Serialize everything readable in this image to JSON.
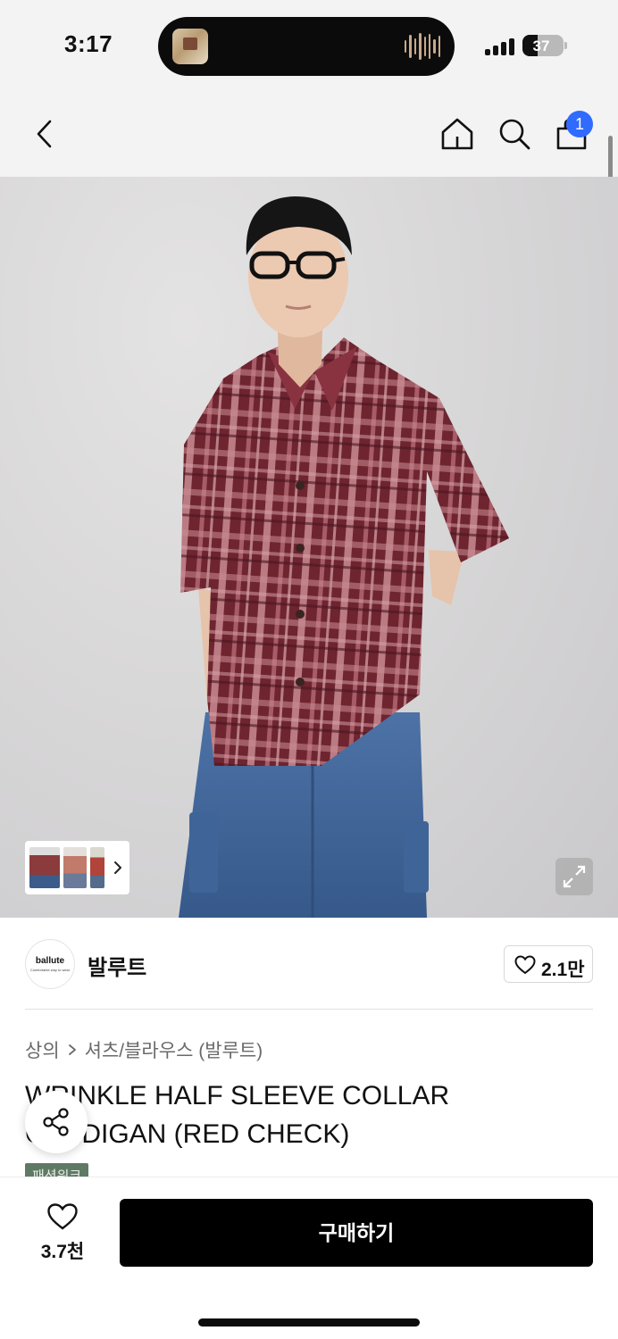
{
  "status_bar": {
    "time": "3:17",
    "battery_level": "37",
    "signal_icon": "cellular-signal-icon",
    "now_playing_icon": "audio-waveform-icon"
  },
  "nav": {
    "back_icon": "chevron-left-icon",
    "home_icon": "home-icon",
    "search_icon": "search-icon",
    "cart_icon": "shopping-bag-icon",
    "cart_badge": "1",
    "badge_color": "#2f6bff"
  },
  "hero": {
    "thumbnail_strip_icon": "chevron-right-icon",
    "expand_icon": "expand-icon"
  },
  "brand": {
    "logo_text": "ballute",
    "logo_tagline": "Comfortable way to wear",
    "name": "발루트",
    "like_count": "2.1만",
    "like_icon": "heart-outline-icon"
  },
  "breadcrumb": {
    "category": "상의",
    "separator_icon": "chevron-right-icon",
    "subcategory": "셔츠/블라우스 (발루트)"
  },
  "product": {
    "title": "WRINKLE HALF SLEEVE COLLAR CARDIGAN (RED CHECK)",
    "tag": "패션위크",
    "tag_color": "#5f7a64",
    "share_icon": "share-icon"
  },
  "bottom_bar": {
    "wish_icon": "heart-outline-icon",
    "wish_count": "3.7천",
    "buy_label": "구매하기"
  }
}
